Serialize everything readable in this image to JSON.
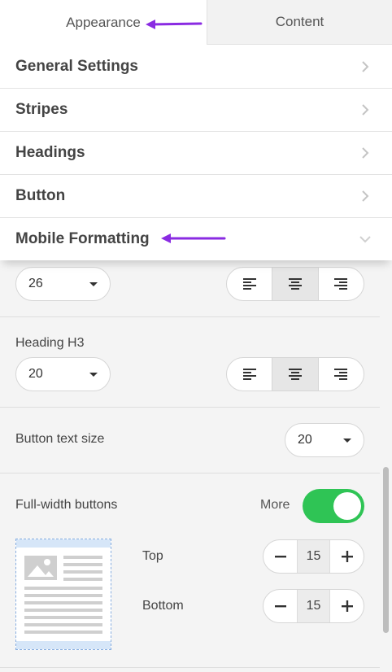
{
  "tabs": [
    {
      "label": "Appearance",
      "active": true
    },
    {
      "label": "Content",
      "active": false
    }
  ],
  "accordion": [
    {
      "label": "General Settings",
      "expanded": false
    },
    {
      "label": "Stripes",
      "expanded": false
    },
    {
      "label": "Headings",
      "expanded": false
    },
    {
      "label": "Button",
      "expanded": false
    },
    {
      "label": "Mobile Formatting",
      "expanded": true
    }
  ],
  "mobile": {
    "heading_h2": {
      "value": "26",
      "alignment": "center"
    },
    "heading_h3": {
      "label": "Heading H3",
      "value": "20",
      "alignment": "center"
    },
    "button_text_size": {
      "label": "Button text size",
      "value": "20"
    },
    "full_width_buttons": {
      "label": "Full-width buttons",
      "more_label": "More",
      "enabled": true
    },
    "padding": {
      "top": {
        "label": "Top",
        "value": "15",
        "minus": "−",
        "plus": "+"
      },
      "bottom": {
        "label": "Bottom",
        "value": "15",
        "minus": "−",
        "plus": "+"
      }
    }
  },
  "colors": {
    "accent_arrow": "#8a2be2",
    "toggle_on": "#2fc455",
    "preview_border": "#88aee0"
  }
}
